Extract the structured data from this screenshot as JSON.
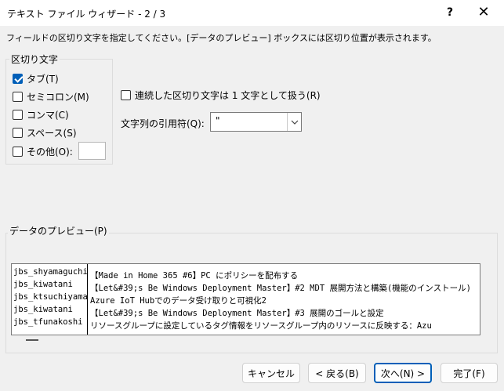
{
  "window": {
    "title": "テキスト ファイル ウィザード - 2 / 3",
    "help_label": "?",
    "close_label": "✕"
  },
  "instruction": "フィールドの区切り文字を指定してください。[データのプレビュー] ボックスには区切り位置が表示されます。",
  "delimiters": {
    "legend": "区切り文字",
    "tab": {
      "label": "タブ(T)",
      "checked": true
    },
    "semicolon": {
      "label": "セミコロン(M)",
      "checked": false
    },
    "comma": {
      "label": "コンマ(C)",
      "checked": false
    },
    "space": {
      "label": "スペース(S)",
      "checked": false
    },
    "other": {
      "label": "その他(O):",
      "checked": false,
      "value": ""
    }
  },
  "consecutive": {
    "label": "連続した区切り文字は 1 文字として扱う(R)",
    "checked": false
  },
  "text_qualifier": {
    "label": "文字列の引用符(Q):",
    "value": "\""
  },
  "preview": {
    "legend": "データのプレビュー(P)",
    "rows": [
      {
        "user": "jbs_shyamaguchi",
        "title": "【Made in Home 365 #6】PC にポリシーを配布する"
      },
      {
        "user": "jbs_kiwatani",
        "title": "【Let&#39;s Be Windows Deployment Master】#2 MDT 展開方法と構築(機能のインストール)"
      },
      {
        "user": "jbs_ktsuchiyama",
        "title": "Azure IoT Hubでのデータ受け取りと可視化2"
      },
      {
        "user": "jbs_kiwatani",
        "title": "【Let&#39;s Be Windows Deployment Master】#3 展開のゴールと設定"
      },
      {
        "user": "jbs_tfunakoshi",
        "title": "リソースグループに設定しているタグ情報をリソースグループ内のリソースに反映する：Azu"
      }
    ]
  },
  "buttons": {
    "cancel": "キャンセル",
    "back": "< 戻る(B)",
    "next": "次へ(N) >",
    "finish": "完了(F)"
  }
}
